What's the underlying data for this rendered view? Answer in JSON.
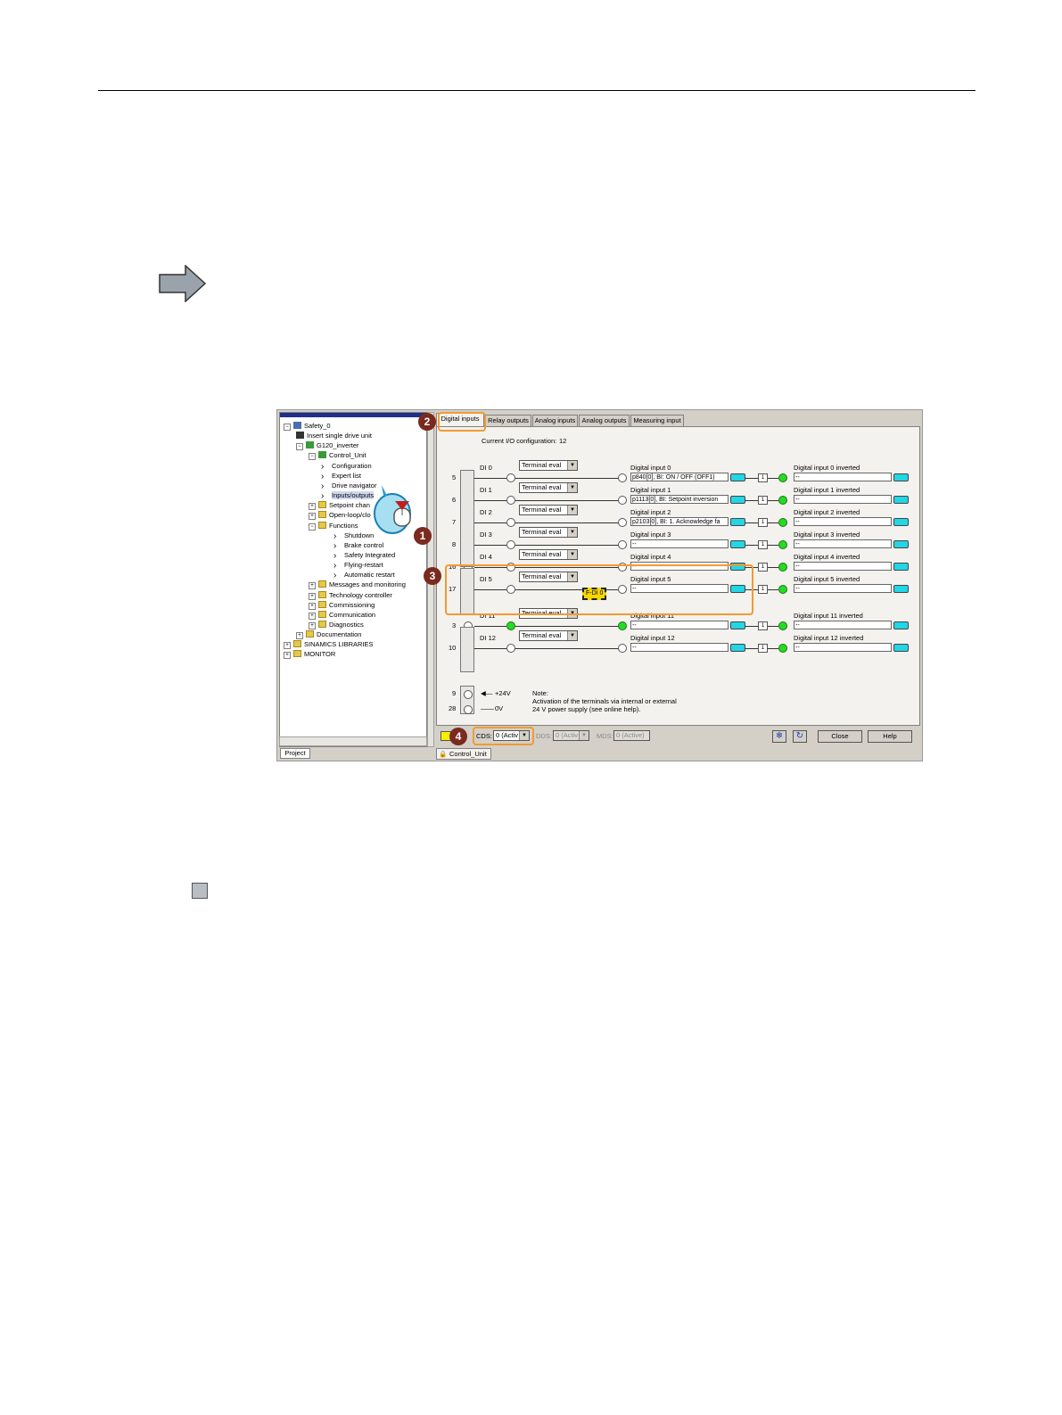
{
  "tree": {
    "items": [
      {
        "label": "Safety_0",
        "type": "project"
      },
      {
        "label": "Insert single drive unit",
        "type": "action"
      },
      {
        "label": "G120_inverter",
        "type": "drive"
      },
      {
        "label": "Control_Unit",
        "type": "cu"
      },
      {
        "label": "Configuration",
        "type": "item"
      },
      {
        "label": "Expert list",
        "type": "item"
      },
      {
        "label": "Drive navigator",
        "type": "item"
      },
      {
        "label": "Inputs/outputs",
        "type": "item"
      },
      {
        "label": "Setpoint chan",
        "type": "folder"
      },
      {
        "label": "Open-loop/clo",
        "type": "folder"
      },
      {
        "label": "Functions",
        "type": "folder"
      },
      {
        "label": "Shutdown",
        "type": "item"
      },
      {
        "label": "Brake control",
        "type": "item"
      },
      {
        "label": "Safety Integrated",
        "type": "item"
      },
      {
        "label": "Flying-restart",
        "type": "item"
      },
      {
        "label": "Automatic restart",
        "type": "item"
      },
      {
        "label": "Messages and monitoring",
        "type": "folder"
      },
      {
        "label": "Technology controller",
        "type": "folder"
      },
      {
        "label": "Commissioning",
        "type": "folder"
      },
      {
        "label": "Communication",
        "type": "folder"
      },
      {
        "label": "Diagnostics",
        "type": "folder"
      },
      {
        "label": "Documentation",
        "type": "folder"
      },
      {
        "label": "SINAMICS LIBRARIES",
        "type": "folder"
      },
      {
        "label": "MONITOR",
        "type": "folder"
      }
    ],
    "bottom_tab": "Project"
  },
  "tabs": [
    "Digital inputs",
    "Relay outputs",
    "Analog inputs",
    "Analog outputs",
    "Measuring input"
  ],
  "config": {
    "label": "Current I/O configuration:",
    "value": "12"
  },
  "rows": [
    {
      "term": "5",
      "di": "DI 0",
      "mode": "Terminal eval",
      "green": false,
      "name": "Digital input 0",
      "value": "p840[0], BI: ON / OFF (OFF1)",
      "inv_name": "Digital input 0 inverted",
      "inv_value": "--"
    },
    {
      "term": "6",
      "di": "DI 1",
      "mode": "Terminal eval",
      "green": false,
      "name": "Digital input 1",
      "value": "p1113[0], BI: Setpoint inversion",
      "inv_name": "Digital input 1 inverted",
      "inv_value": "--"
    },
    {
      "term": "7",
      "di": "DI 2",
      "mode": "Terminal eval",
      "green": false,
      "name": "Digital input 2",
      "value": "p2103[0], BI: 1. Acknowledge fa",
      "inv_name": "Digital input 2 inverted",
      "inv_value": "--"
    },
    {
      "term": "8",
      "di": "DI 3",
      "mode": "Terminal eval",
      "green": false,
      "name": "Digital input 3",
      "value": "--",
      "inv_name": "Digital input 3 inverted",
      "inv_value": "--"
    },
    {
      "term": "16",
      "di": "DI 4",
      "mode": "Terminal eval",
      "green": false,
      "name": "Digital input 4",
      "value": "--",
      "inv_name": "Digital input 4 inverted",
      "inv_value": "--"
    },
    {
      "term": "17",
      "di": "DI 5",
      "mode": "Terminal eval",
      "green": false,
      "name": "Digital input 5",
      "value": "--",
      "inv_name": "Digital input 5 inverted",
      "inv_value": "--"
    },
    {
      "term": "3",
      "di": "DI 11",
      "mode": "Terminal eval",
      "green": true,
      "name": "Digital input 11",
      "value": "--",
      "inv_name": "Digital input 11 inverted",
      "inv_value": "--"
    },
    {
      "term": "10",
      "di": "DI 12",
      "mode": "Terminal eval",
      "green": false,
      "name": "Digital input 12",
      "value": "--",
      "inv_name": "Digital input 12 inverted",
      "inv_value": "--"
    }
  ],
  "fdi_label": "F-DI 0",
  "inv_box_label": "1",
  "power": {
    "term_a": "9",
    "label_a": "+24V",
    "term_b": "28",
    "label_b": "0V",
    "note_title": "Note:",
    "note_line1": "Activation of the terminals via internal or external",
    "note_line2": "24 V power supply (see online help)."
  },
  "bottom": {
    "cds_label": "CDS:",
    "cds_value": "0 (Activ",
    "dds_label": "DDS:",
    "dds_value": "0 (Activ",
    "mds_label": "MDS:",
    "mds_value": "0 (Active)",
    "close": "Close",
    "help": "Help",
    "tab": "Control_Unit"
  },
  "badges": [
    "1",
    "2",
    "3",
    "4"
  ],
  "colors": {
    "accent": "#f29a33",
    "badge": "#7a2a1e",
    "active_led": "#22dd22",
    "cyan_button": "#22d6e6"
  }
}
